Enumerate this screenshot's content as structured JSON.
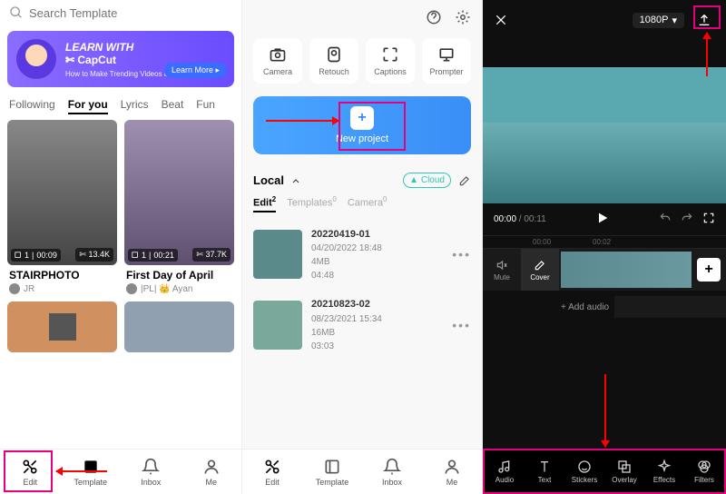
{
  "s1": {
    "search_placeholder": "Search Template",
    "banner": {
      "line1": "LEARN WITH",
      "line2": "✄ CapCut",
      "line3": "How to Make Trending Videos and more",
      "btn": "Learn More ▸"
    },
    "tabs": [
      "Following",
      "For you",
      "Lyrics",
      "Beat",
      "Fun"
    ],
    "active_tab": 1,
    "cards": [
      {
        "title": "STAIRPHOTO",
        "user": "JR",
        "clips": "1",
        "dur": "00:09",
        "uses": "13.4K"
      },
      {
        "title": "First Day of April",
        "user": "|PL| 👑 Ayan",
        "clips": "1",
        "dur": "00:21",
        "uses": "37.7K"
      }
    ],
    "tabbar": [
      {
        "l": "Edit"
      },
      {
        "l": "Template"
      },
      {
        "l": "Inbox"
      },
      {
        "l": "Me"
      }
    ]
  },
  "s2": {
    "tools": [
      {
        "l": "Camera"
      },
      {
        "l": "Retouch"
      },
      {
        "l": "Captions"
      },
      {
        "l": "Prompter"
      }
    ],
    "newproject": "New project",
    "local": "Local",
    "cloud": "Cloud",
    "ltabs": [
      {
        "l": "Edit",
        "n": "2"
      },
      {
        "l": "Templates",
        "n": "0"
      },
      {
        "l": "Camera",
        "n": "0"
      }
    ],
    "active_ltab": 0,
    "projects": [
      {
        "title": "20220419-01",
        "date": "04/20/2022 18:48",
        "size": "4MB",
        "dur": "04:48"
      },
      {
        "title": "20210823-02",
        "date": "08/23/2021 15:34",
        "size": "16MB",
        "dur": "03:03"
      }
    ],
    "tabbar": [
      {
        "l": "Edit"
      },
      {
        "l": "Template"
      },
      {
        "l": "Inbox"
      },
      {
        "l": "Me"
      }
    ]
  },
  "s3": {
    "resolution": "1080P",
    "time_cur": "00:00",
    "time_tot": "00:11",
    "ruler": [
      "00:00",
      "00:02"
    ],
    "mute": "Mute",
    "cover": "Cover",
    "addaudio": "+ Add audio",
    "tools": [
      {
        "l": "Audio"
      },
      {
        "l": "Text"
      },
      {
        "l": "Stickers"
      },
      {
        "l": "Overlay"
      },
      {
        "l": "Effects"
      },
      {
        "l": "Filters"
      }
    ]
  }
}
